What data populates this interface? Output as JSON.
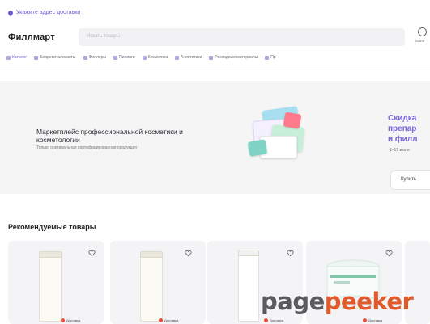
{
  "header": {
    "location": "Укажите адрес доставки",
    "logo": "Филлмарт",
    "search_placeholder": "Искать товары",
    "user_label": "Войти"
  },
  "categories": [
    {
      "label": "Каталог",
      "active": true
    },
    {
      "label": "Биоревитализанты"
    },
    {
      "label": "Филлеры"
    },
    {
      "label": "Пилинги"
    },
    {
      "label": "Косметика"
    },
    {
      "label": "Анестетики"
    },
    {
      "label": "Расходные материалы"
    },
    {
      "label": "Пр"
    }
  ],
  "banner": {
    "title": "Маркетплейс профессиональной косметики и косметологии",
    "subtitle": "Только оригинальная сертифицированная продукция",
    "right_title": "Скидка\nпрепар\nи филл",
    "right_small": "1–15 июля",
    "buy_button": "Купить"
  },
  "recommended": {
    "title": "Рекомендуемые товары",
    "cards": [
      {
        "tag": "Доставка"
      },
      {
        "tag": "Доставка"
      },
      {
        "tag": "Доставка"
      },
      {
        "tag": "Доставка"
      }
    ]
  },
  "watermark": {
    "part_a": "page",
    "part_b": "peeker"
  },
  "colors": {
    "accent": "#7a66e0",
    "watermark_orange": "#e05a2c"
  }
}
